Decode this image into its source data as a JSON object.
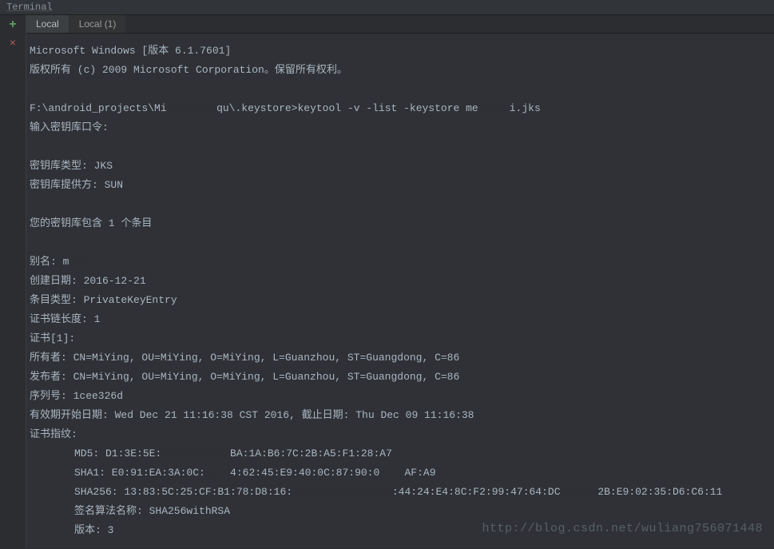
{
  "title": "Terminal",
  "gutter": {
    "add": "+",
    "close": "×"
  },
  "tabs": [
    {
      "label": "Local",
      "active": true
    },
    {
      "label": "Local (1)",
      "active": false
    }
  ],
  "lines": {
    "l1": "Microsoft Windows [版本 6.1.7601]",
    "l2": "版权所有 (c) 2009 Microsoft Corporation。保留所有权利。",
    "l3": "",
    "l4_pre": "F:\\android_projects\\Mi",
    "l4_mid": "qu\\.keystore>keytool -v -list -keystore me",
    "l4_end": "i.jks",
    "l5": "输入密钥库口令:",
    "l6": "",
    "l7": "密钥库类型: JKS",
    "l8": "密钥库提供方: SUN",
    "l9": "",
    "l10": "您的密钥库包含 1 个条目",
    "l11": "",
    "l12_label": "别名: ",
    "l12_val": "m",
    "l13": "创建日期: 2016-12-21",
    "l14": "条目类型: PrivateKeyEntry",
    "l15": "证书链长度: 1",
    "l16": "证书[1]:",
    "l17": "所有者: CN=MiYing, OU=MiYing, O=MiYing, L=Guanzhou, ST=Guangdong, C=86",
    "l18": "发布者: CN=MiYing, OU=MiYing, O=MiYing, L=Guanzhou, ST=Guangdong, C=86",
    "l19": "序列号: 1cee326d",
    "l20": "有效期开始日期: Wed Dec 21 11:16:38 CST 2016, 截止日期: Thu Dec 09 11:16:38",
    "l21": "证书指纹:",
    "l22_pre": "MD5: D1:3E:5E:",
    "l22_end": "BA:1A:B6:7C:2B:A5:F1:28:A7",
    "l23_pre": "SHA1: E0:91:EA:3A:0C:",
    "l23_mid": "4:62:45:E9:40:0C:87:90:0",
    "l23_end": "AF:A9",
    "l24_pre": "SHA256: 13:83:5C:25:CF:B1:78:D8:16:",
    "l24_mid": ":44:24:E4:8C:F2:99:47:64:DC",
    "l24_end": "2B:E9:02:35:D6:C6:11",
    "l25": "签名算法名称: SHA256withRSA",
    "l26": "版本: 3"
  },
  "watermark": "http://blog.csdn.net/wuliang756071448"
}
